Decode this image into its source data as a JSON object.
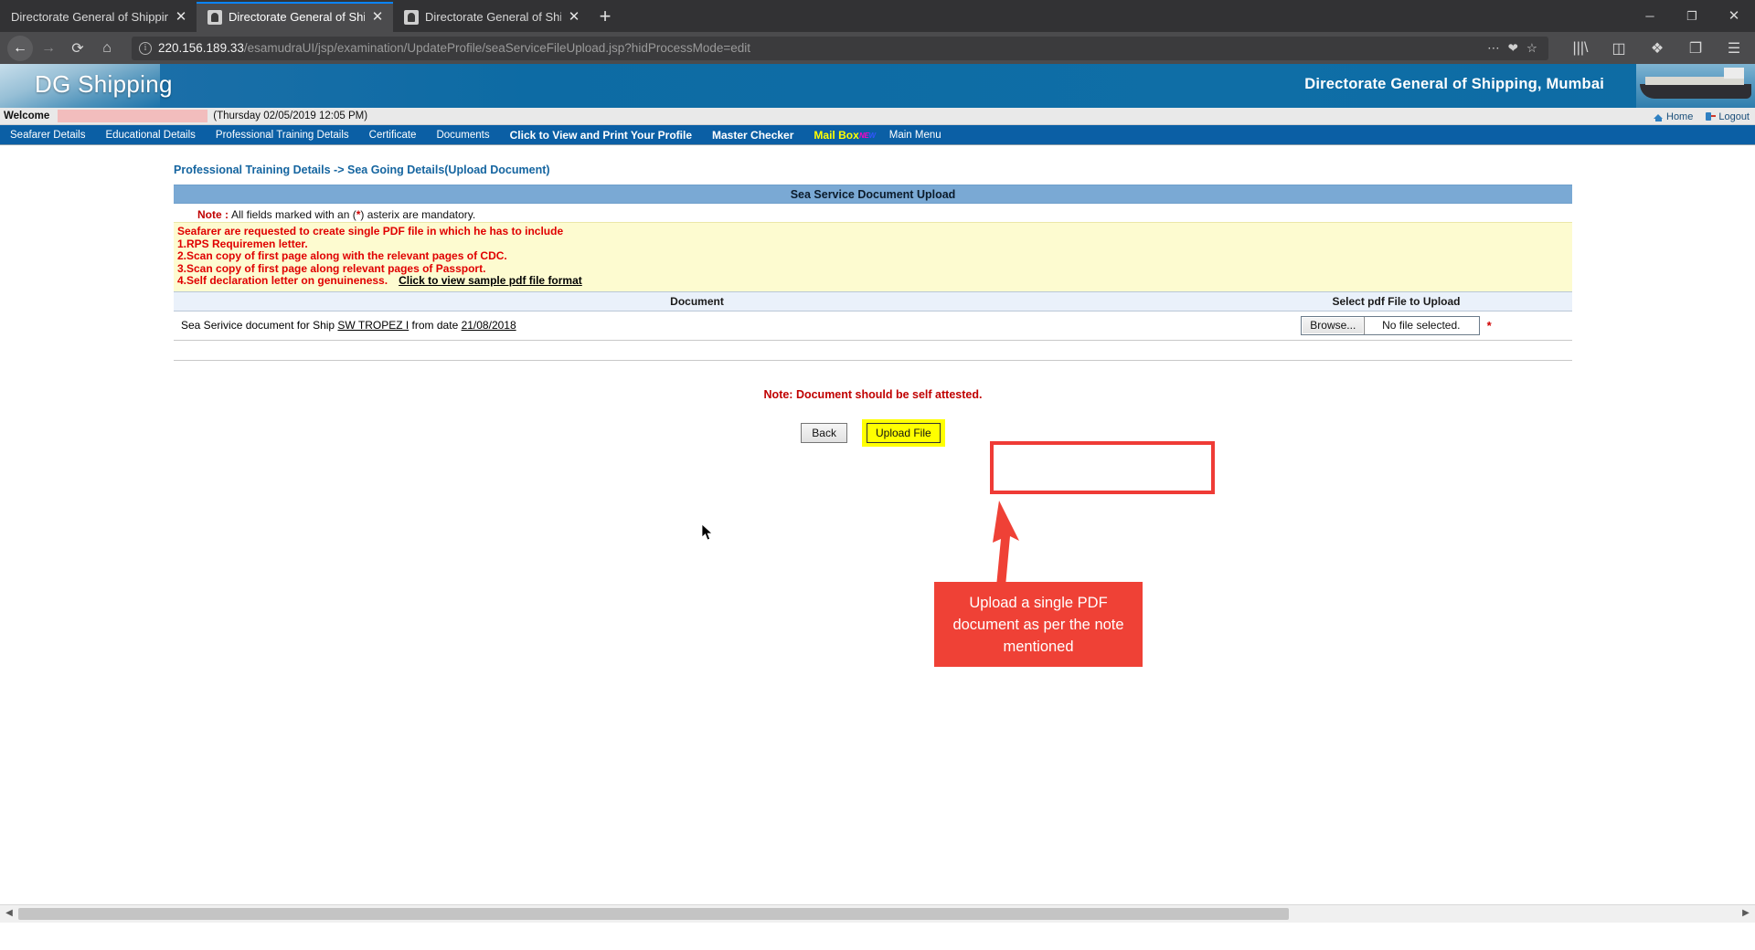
{
  "browser": {
    "tabs": [
      {
        "title": "Directorate General of Shipping : Go",
        "close": "✕",
        "active": false
      },
      {
        "title": "Directorate General of Shipping",
        "close": "✕",
        "active": true
      },
      {
        "title": "Directorate General of Shipping",
        "close": "✕",
        "active": false
      }
    ],
    "new_tab_label": "+",
    "window_controls": {
      "minimize": "─",
      "maximize": "❐",
      "close": "✕"
    },
    "nav": {
      "back": "←",
      "forward": "→",
      "reload": "⟳",
      "home": "⌂",
      "info_icon": "i",
      "url_host": "220.156.189.33",
      "url_path": "/esamudraUI/jsp/examination/UpdateProfile/seaServiceFileUpload.jsp?hidProcessMode=edit",
      "more_actions": "⋯",
      "pocket": "❤",
      "bookmark_star": "☆",
      "library": "|||\\",
      "sidebars": "◫",
      "extension": "❖",
      "container": "❐",
      "menu": "☰"
    }
  },
  "header": {
    "logo": "DG Shipping",
    "department": "Directorate General of Shipping, Mumbai"
  },
  "welcome": {
    "label": "Welcome",
    "username_redacted": "",
    "datetime": "(Thursday 02/05/2019 12:05 PM)",
    "home_label": "Home",
    "logout_label": "Logout"
  },
  "navmenu": {
    "items": [
      {
        "label": "Seafarer Details",
        "style": "normal"
      },
      {
        "label": "Educational Details",
        "style": "normal"
      },
      {
        "label": "Professional Training Details",
        "style": "normal"
      },
      {
        "label": "Certificate",
        "style": "normal"
      },
      {
        "label": "Documents",
        "style": "normal"
      },
      {
        "label": "Click to View and Print Your Profile",
        "style": "bold"
      },
      {
        "label": "Master Checker",
        "style": "bold"
      },
      {
        "label": "Mail Box",
        "style": "mail",
        "badge": "NEW"
      },
      {
        "label": "Main Menu",
        "style": "normal"
      }
    ]
  },
  "main": {
    "breadcrumb": "Professional Training Details -> Sea Going Details(Upload Document)",
    "section_title": "Sea Service Document Upload",
    "mandatory_note": {
      "prefix": "Note :",
      "text_before": "All fields marked with an (",
      "asterisk": "*",
      "text_after": ") asterix are mandatory."
    },
    "instructions": {
      "lines": [
        "Seafarer are requested to create single PDF file in which he has to include",
        "1.RPS Requiremen letter.",
        "2.Scan copy of first page along with the relevant pages of CDC.",
        "3.Scan copy of first page along relevant pages of Passport.",
        "4.Self declaration letter on genuineness."
      ],
      "sample_link": "Click to view sample pdf file format"
    },
    "table": {
      "headers": {
        "document": "Document",
        "upload": "Select pdf File to Upload"
      },
      "row": {
        "text_1": "Sea Serivice document for Ship ",
        "ship_name": "SW TROPEZ I",
        "text_2": " from date ",
        "date": "21/08/2018",
        "browse_label": "Browse...",
        "file_status": "No file selected.",
        "required_marker": "*"
      }
    },
    "attested_note": "Note: Document should be self attested.",
    "buttons": {
      "back": "Back",
      "upload": "Upload File"
    }
  },
  "annotation": {
    "callout_text": "Upload a single PDF document as per the note mentioned",
    "box_color": "#ef4136"
  },
  "scrollbar": {
    "left_arrow": "◀",
    "right_arrow": "▶"
  }
}
